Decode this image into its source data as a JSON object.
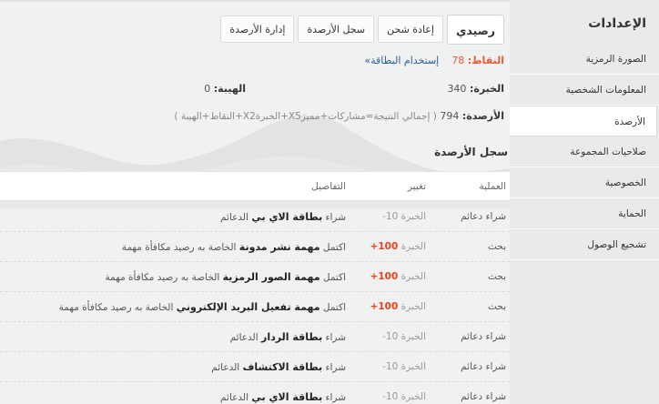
{
  "sidebar": {
    "title": "الإعدادات",
    "items": [
      {
        "label": "الصورة الرمزية"
      },
      {
        "label": "المعلومات الشخصية"
      },
      {
        "label": "الأرصدة"
      },
      {
        "label": "صلاحيات المجموعة"
      },
      {
        "label": "الخصوصية"
      },
      {
        "label": "الحماية"
      },
      {
        "label": "تشجيع الوصول"
      }
    ],
    "active_index": 2
  },
  "tabs": [
    {
      "label": "رصيدي"
    },
    {
      "label": "إعادة شحن"
    },
    {
      "label": "سجل الأرصدة"
    },
    {
      "label": "إدارة الأرصدة"
    }
  ],
  "stats": {
    "points_label": "النقاط:",
    "points_value": "78",
    "use_card": "إستخدام البطاقة»",
    "exp_label": "الخبرة:",
    "exp_value": "340",
    "prestige_label": "الهيبة:",
    "prestige_value": "0",
    "credits_label": "الأرصدة:",
    "credits_value": "794",
    "formula": "( إجمالي النتيجة=مشاركات+مميزX5+الخبرةX2+النقاط+الهيبة )"
  },
  "log": {
    "title": "سجل الأرصدة",
    "headers": {
      "operation": "العملية",
      "change": "تغيير",
      "details": "التفاصيل"
    },
    "rows": [
      {
        "operation": "شراء دعائم",
        "change_label": "الخبرة",
        "change_value": "10-",
        "change_type": "neg",
        "details_pre": "شراء",
        "details_bold": "بطاقة الاي بي",
        "details_post": "الدعائم"
      },
      {
        "operation": "بحث",
        "change_label": "الخبرة",
        "change_value": "100+",
        "change_type": "pos",
        "details_pre": "اكتمل",
        "details_bold": "مهمة نشر مدونة",
        "details_post": "الخاصة به رصيد مكافأة مهمة"
      },
      {
        "operation": "بحث",
        "change_label": "الخبرة",
        "change_value": "100+",
        "change_type": "pos",
        "details_pre": "اكتمل",
        "details_bold": "مهمة الصور الرمزية",
        "details_post": "الخاصة به رصيد مكافأة مهمة"
      },
      {
        "operation": "بحث",
        "change_label": "الخبرة",
        "change_value": "100+",
        "change_type": "pos",
        "details_pre": "اكتمل",
        "details_bold": "مهمة تفعيل البريد الإلكتروني",
        "details_post": "الخاصة به رصيد مكافأة مهمة"
      },
      {
        "operation": "شراء دعائم",
        "change_label": "الخبرة",
        "change_value": "10-",
        "change_type": "neg",
        "details_pre": "شراء",
        "details_bold": "بطاقة الردار",
        "details_post": "الدعائم"
      },
      {
        "operation": "شراء دعائم",
        "change_label": "الخبرة",
        "change_value": "10-",
        "change_type": "neg",
        "details_pre": "شراء",
        "details_bold": "بطاقة الاكتشاف",
        "details_post": "الدعائم"
      },
      {
        "operation": "شراء دعائم",
        "change_label": "الخبرة",
        "change_value": "10-",
        "change_type": "neg",
        "details_pre": "شراء",
        "details_bold": "بطاقة الاي بي",
        "details_post": "الدعائم"
      }
    ]
  }
}
